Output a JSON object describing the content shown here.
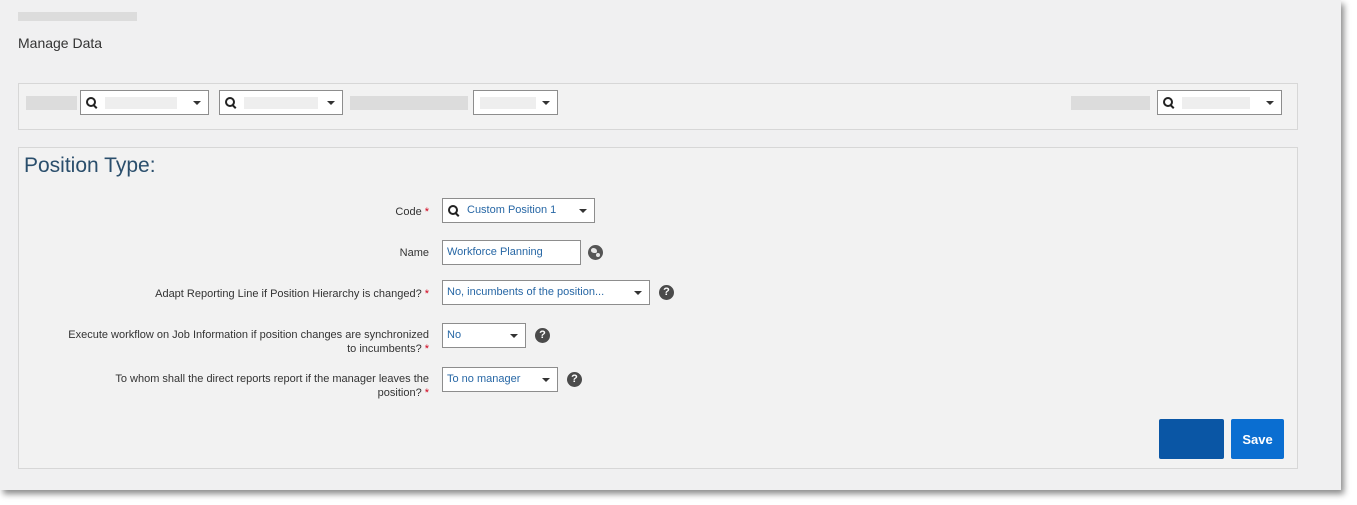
{
  "page": {
    "title": "Manage Data"
  },
  "section": {
    "title": "Position Type:"
  },
  "fields": {
    "code": {
      "label": "Code",
      "value": "Custom Position 1"
    },
    "name": {
      "label": "Name",
      "value": "Workforce Planning"
    },
    "adapt_reporting": {
      "label": "Adapt Reporting Line if Position Hierarchy is changed?",
      "value": "No, incumbents of the position..."
    },
    "execute_workflow": {
      "label_line1": "Execute workflow on Job Information if position changes are synchronized",
      "label_line2": "to incumbents?",
      "value": "No"
    },
    "direct_reports": {
      "label_line1": "To whom shall the direct reports report if the manager leaves the",
      "label_line2": "position?",
      "value": "To no manager"
    },
    "required_marker": "*"
  },
  "help": {
    "glyph": "?"
  },
  "buttons": {
    "save_label": "Save"
  },
  "icons": {
    "search": "search-icon",
    "dropdown": "chevron-down-icon",
    "help": "help-icon",
    "translate": "globe-icon"
  },
  "colors": {
    "primary_button": "#0a6ed1",
    "secondary_button": "#0a56a5",
    "value_text": "#2767a5",
    "required": "#d0021b",
    "section_title": "#2a4e6c"
  }
}
